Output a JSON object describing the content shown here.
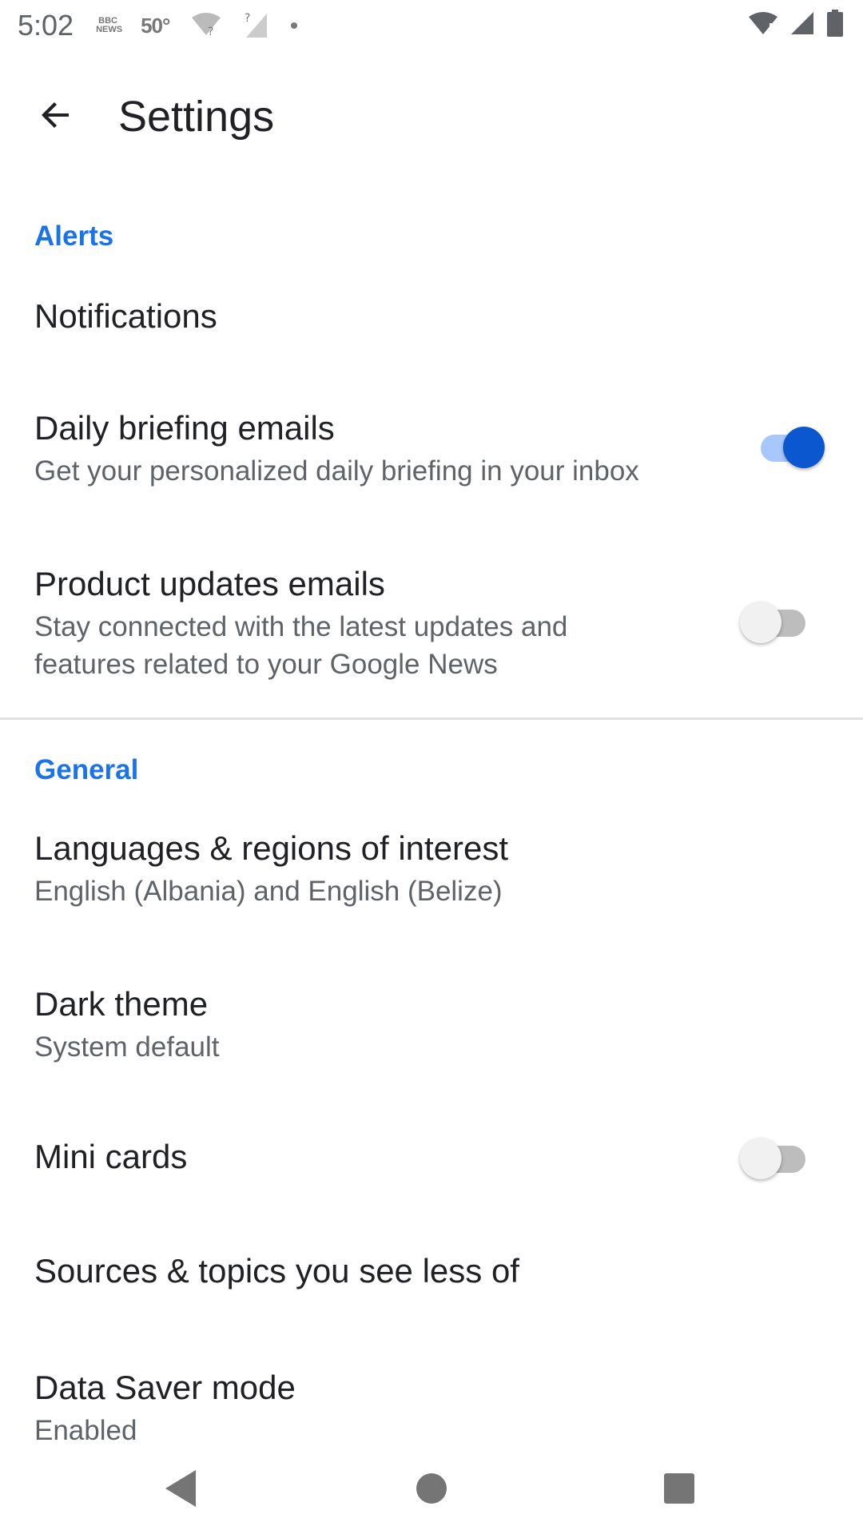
{
  "status_bar": {
    "time": "5:02",
    "news_badge": "BBC NEWS",
    "temperature": "50°"
  },
  "app_bar": {
    "title": "Settings"
  },
  "sections": {
    "alerts": "Alerts",
    "general": "General"
  },
  "items": {
    "notifications": {
      "title": "Notifications"
    },
    "daily_briefing": {
      "title": "Daily briefing emails",
      "subtitle": "Get your personalized daily briefing in your inbox",
      "enabled": true
    },
    "product_updates": {
      "title": "Product updates emails",
      "subtitle": "Stay connected with the latest updates and features related to your Google News",
      "enabled": false
    },
    "languages": {
      "title": "Languages & regions of interest",
      "subtitle": "English (Albania) and English (Belize)"
    },
    "dark_theme": {
      "title": "Dark theme",
      "subtitle": "System default"
    },
    "mini_cards": {
      "title": "Mini cards",
      "enabled": false
    },
    "sources_topics": {
      "title": "Sources & topics you see less of"
    },
    "data_saver": {
      "title": "Data Saver mode",
      "subtitle": "Enabled"
    }
  },
  "colors": {
    "accent": "#1a73e8",
    "toggle_on_thumb": "#0b57d0",
    "toggle_on_track": "#a8c7fa"
  }
}
